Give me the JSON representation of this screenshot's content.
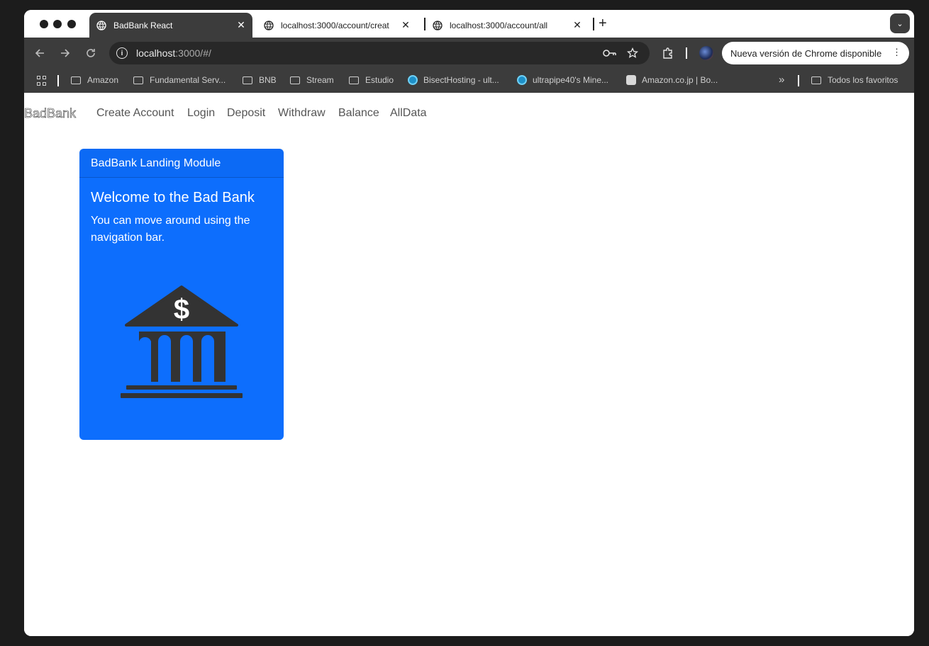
{
  "browser": {
    "tabs": [
      {
        "title": "BadBank React",
        "active": true
      },
      {
        "title": "localhost:3000/account/creat",
        "active": false
      },
      {
        "title": "localhost:3000/account/all",
        "active": false
      }
    ],
    "close_glyph": "✕",
    "new_tab_glyph": "+",
    "tab_menu_glyph": "⌄",
    "url_host": "localhost",
    "url_path": ":3000/#/",
    "update_label": "Nueva versión de Chrome disponible",
    "icons": {
      "back": "back-arrow-icon",
      "forward": "forward-arrow-icon",
      "reload": "reload-icon",
      "site_info": "info-icon",
      "password": "key-icon",
      "bookmark": "star-icon",
      "extensions": "puzzle-icon",
      "profile": "avatar-icon",
      "menu": "vertical-dots-icon"
    }
  },
  "bookmarks": {
    "items": [
      {
        "label": "Amazon",
        "type": "folder"
      },
      {
        "label": "Fundamental Serv...",
        "type": "folder"
      },
      {
        "label": "BNB",
        "type": "folder"
      },
      {
        "label": "Stream",
        "type": "folder"
      },
      {
        "label": "Estudio",
        "type": "folder"
      },
      {
        "label": "BisectHosting - ult...",
        "type": "site"
      },
      {
        "label": "ultrapipe40's Mine...",
        "type": "site"
      },
      {
        "label": "Amazon.co.jp | Bo...",
        "type": "site"
      }
    ],
    "overflow_glyph": "»",
    "all_favorites": "Todos los favoritos"
  },
  "app": {
    "brand": "BadBank",
    "nav": [
      "Create Account",
      "Login",
      "Deposit",
      "Withdraw",
      "Balance",
      "AllData"
    ],
    "card": {
      "header": "BadBank Landing Module",
      "title": "Welcome to the Bad Bank",
      "text": "You can move around using the navigation bar.",
      "image": "bank-icon",
      "bg_color": "#0d6efd"
    }
  }
}
